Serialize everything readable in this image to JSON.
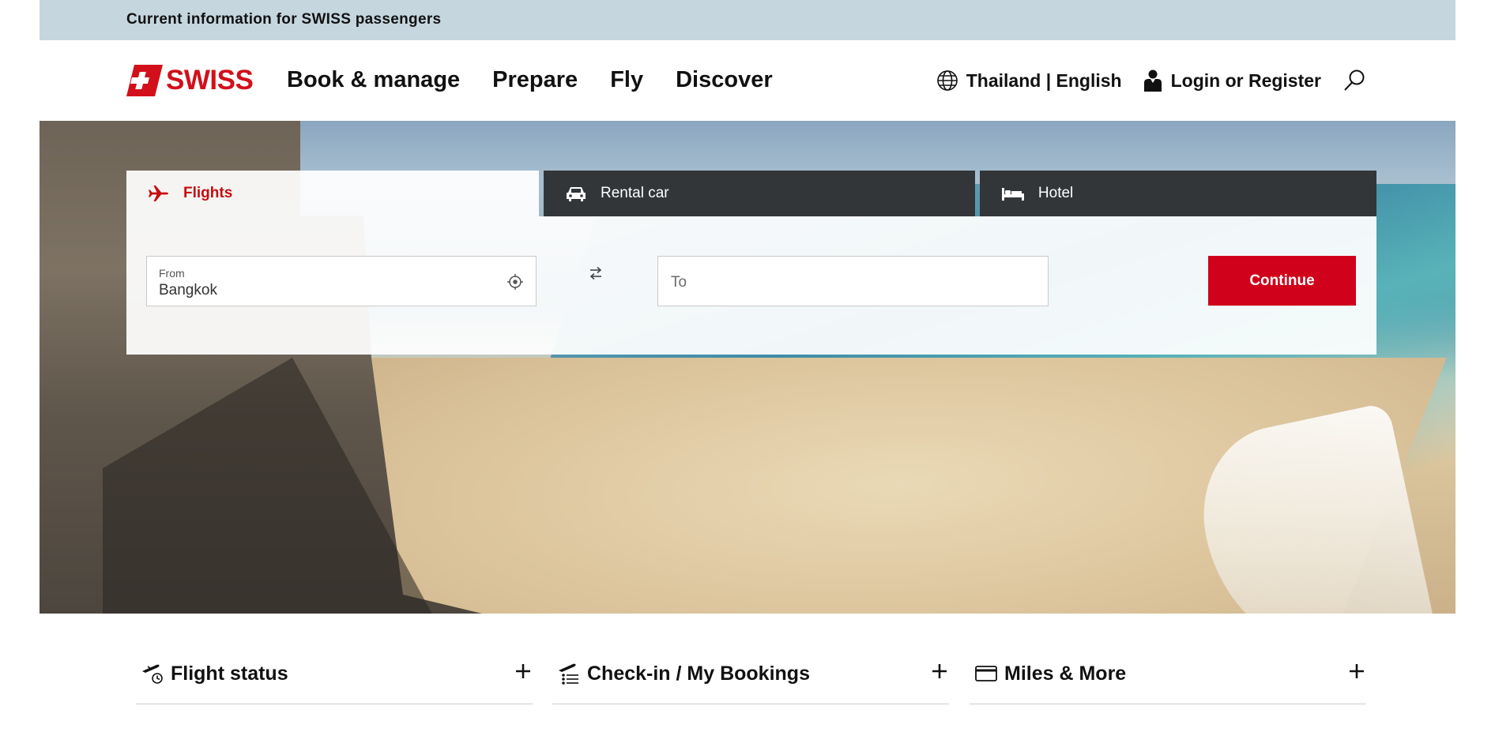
{
  "infobar": {
    "text": "Current information for SWISS passengers"
  },
  "header": {
    "brand": "SWISS",
    "nav": [
      "Book & manage",
      "Prepare",
      "Fly",
      "Discover"
    ],
    "locale": "Thailand | English",
    "login": "Login or Register"
  },
  "booking": {
    "tabs": [
      {
        "label": "Flights",
        "icon": "plane-icon",
        "active": true
      },
      {
        "label": "Rental car",
        "icon": "car-icon",
        "active": false
      },
      {
        "label": "Hotel",
        "icon": "bed-icon",
        "active": false
      }
    ],
    "from": {
      "label": "From",
      "value": "Bangkok"
    },
    "to": {
      "placeholder": "To"
    },
    "continue_label": "Continue"
  },
  "quicklinks": [
    {
      "label": "Flight status",
      "icon": "flight-status-icon"
    },
    {
      "label": "Check-in / My Bookings",
      "icon": "check-in-icon"
    },
    {
      "label": "Miles & More",
      "icon": "card-icon"
    }
  ],
  "colors": {
    "brand_red": "#d0021b",
    "infobar_bg": "#c5d6df",
    "tab_dark": "#333639"
  }
}
